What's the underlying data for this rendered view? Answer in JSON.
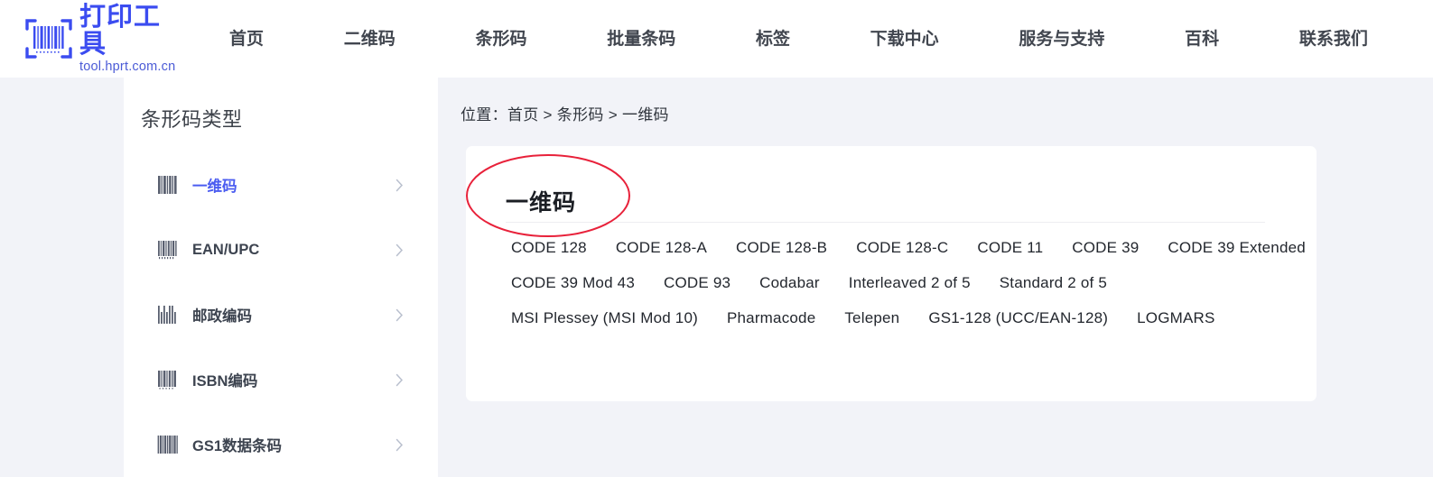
{
  "header": {
    "logo": {
      "icon": "barcode-scan-frame-icon",
      "title": "打印工具",
      "subtitle": "tool.hprt.com.cn",
      "color": "#3b4cf0"
    },
    "nav_items": [
      {
        "label": "首页",
        "name": "nav-item-home"
      },
      {
        "label": "二维码",
        "name": "nav-item-qrcode"
      },
      {
        "label": "条形码",
        "name": "nav-item-barcode"
      },
      {
        "label": "批量条码",
        "name": "nav-item-batch-barcode"
      },
      {
        "label": "标签",
        "name": "nav-item-label"
      },
      {
        "label": "下载中心",
        "name": "nav-item-download-center"
      },
      {
        "label": "服务与支持",
        "name": "nav-item-service-support"
      },
      {
        "label": "百科",
        "name": "nav-item-encyclopedia"
      },
      {
        "label": "联系我们",
        "name": "nav-item-contact-us"
      }
    ]
  },
  "sidebar": {
    "title": "条形码类型",
    "items": [
      {
        "label": "一维码",
        "icon": "barcode-icon",
        "active": true,
        "chevron": "chevron-right-icon"
      },
      {
        "label": "EAN/UPC",
        "icon": "barcode-icon",
        "active": false,
        "chevron": "chevron-right-icon"
      },
      {
        "label": "邮政编码",
        "icon": "postal-barcode-icon",
        "active": false,
        "chevron": "chevron-right-icon"
      },
      {
        "label": "ISBN编码",
        "icon": "barcode-icon",
        "active": false,
        "chevron": "chevron-right-icon"
      },
      {
        "label": "GS1数据条码",
        "icon": "barcode-icon",
        "active": false,
        "chevron": "chevron-right-icon"
      }
    ],
    "active_color": "#4b5cf0"
  },
  "main": {
    "breadcrumb": "位置：首页 > 条形码 > 一维码",
    "card_title": "一维码",
    "link_rows": [
      [
        "CODE 128",
        "CODE 128-A",
        "CODE 128-B",
        "CODE 128-C",
        "CODE 11",
        "CODE 39",
        "CODE 39 Extended"
      ],
      [
        "CODE 39 Mod 43",
        "CODE 93",
        "Codabar",
        "Interleaved 2 of 5",
        "Standard 2 of 5"
      ],
      [
        "MSI Plessey (MSI Mod 10)",
        "Pharmacode",
        "Telepen",
        "GS1-128 (UCC/EAN-128)",
        "LOGMARS"
      ]
    ]
  },
  "annotation": {
    "shape": "ellipse",
    "color": "#e8213a",
    "target": "card_title"
  }
}
